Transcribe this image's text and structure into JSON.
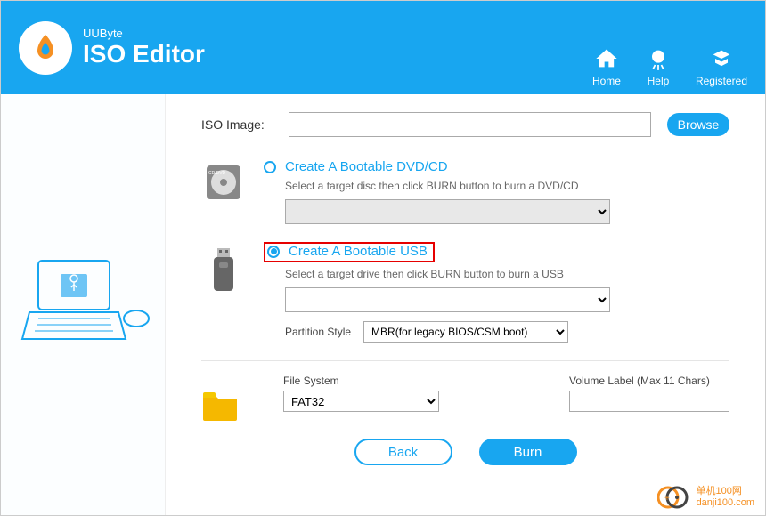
{
  "titlebar": {
    "dropdown": "▾",
    "minimize": "—",
    "close": "✕"
  },
  "header": {
    "brand": "UUByte",
    "product": "ISO Editor",
    "nav": {
      "home": "Home",
      "help": "Help",
      "registered": "Registered"
    }
  },
  "iso": {
    "label": "ISO Image:",
    "value": "",
    "browse": "Browse"
  },
  "optionDvd": {
    "label": "Create A Bootable DVD/CD",
    "desc": "Select a target disc then click BURN button to burn a DVD/CD",
    "selectValue": ""
  },
  "optionUsb": {
    "label": "Create A Bootable USB",
    "desc": "Select a target drive then click BURN button to burn a USB",
    "selectValue": "",
    "partitionLabel": "Partition Style",
    "partitionValue": "MBR(for legacy BIOS/CSM boot)"
  },
  "fileSystem": {
    "label": "File System",
    "value": "FAT32"
  },
  "volumeLabel": {
    "label": "Volume Label (Max 11 Chars)",
    "value": ""
  },
  "buttons": {
    "back": "Back",
    "burn": "Burn"
  },
  "watermark": {
    "line1": "单机100网",
    "line2": "danji100.com"
  }
}
